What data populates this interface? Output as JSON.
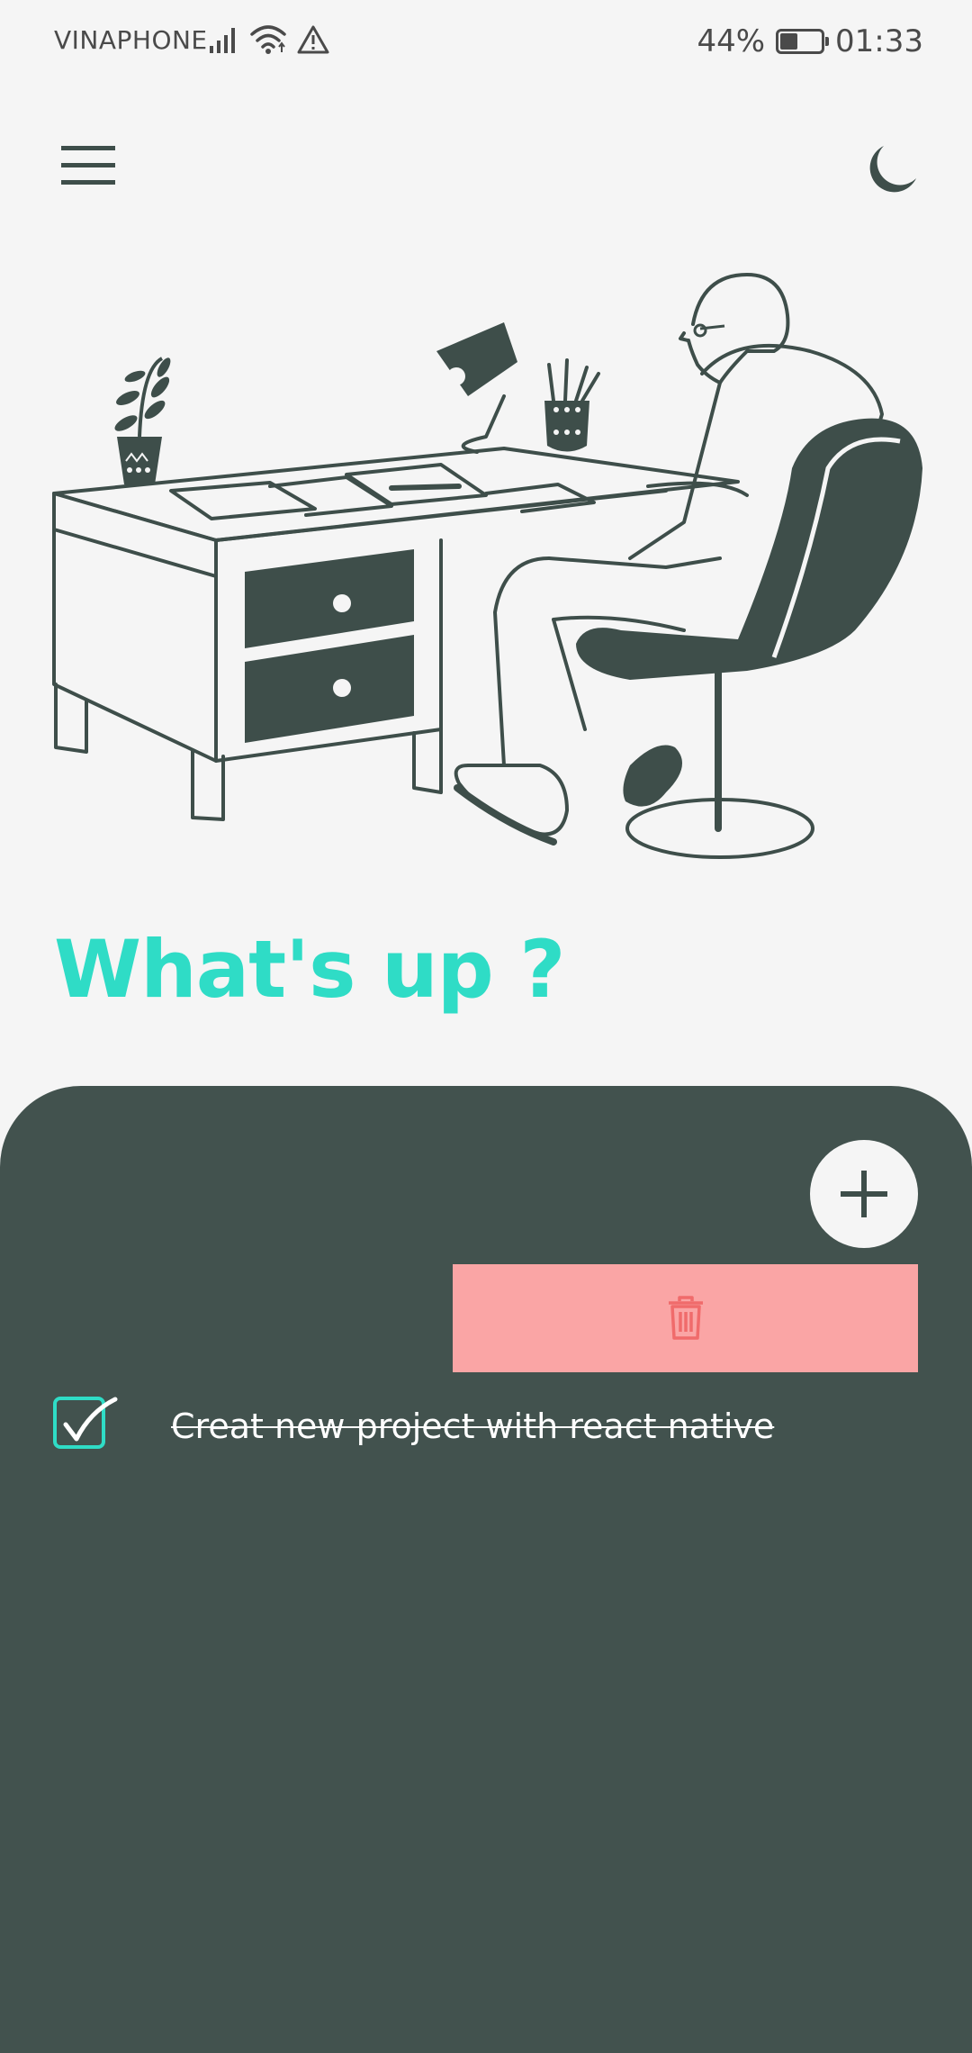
{
  "status_bar": {
    "carrier": "VINAPHONE",
    "battery_percent": "44%",
    "battery_level": 0.44,
    "time": "01:33",
    "icons": [
      "signal-icon",
      "wifi-icon",
      "alert-icon",
      "battery-icon"
    ]
  },
  "header": {
    "menu_icon": "hamburger-menu-icon",
    "theme_icon": "moon-icon"
  },
  "main": {
    "title": "What's up ?"
  },
  "panel": {
    "add_icon": "plus-icon",
    "delete_icon": "trash-icon",
    "tasks": [
      {
        "label": "Creat new project with react native",
        "done": true
      }
    ]
  },
  "colors": {
    "background": "#f5f5f5",
    "dark": "#42524e",
    "accent": "#2fdcc6",
    "delete_bg": "#faa5a5",
    "delete_icon": "#f06b6b"
  }
}
